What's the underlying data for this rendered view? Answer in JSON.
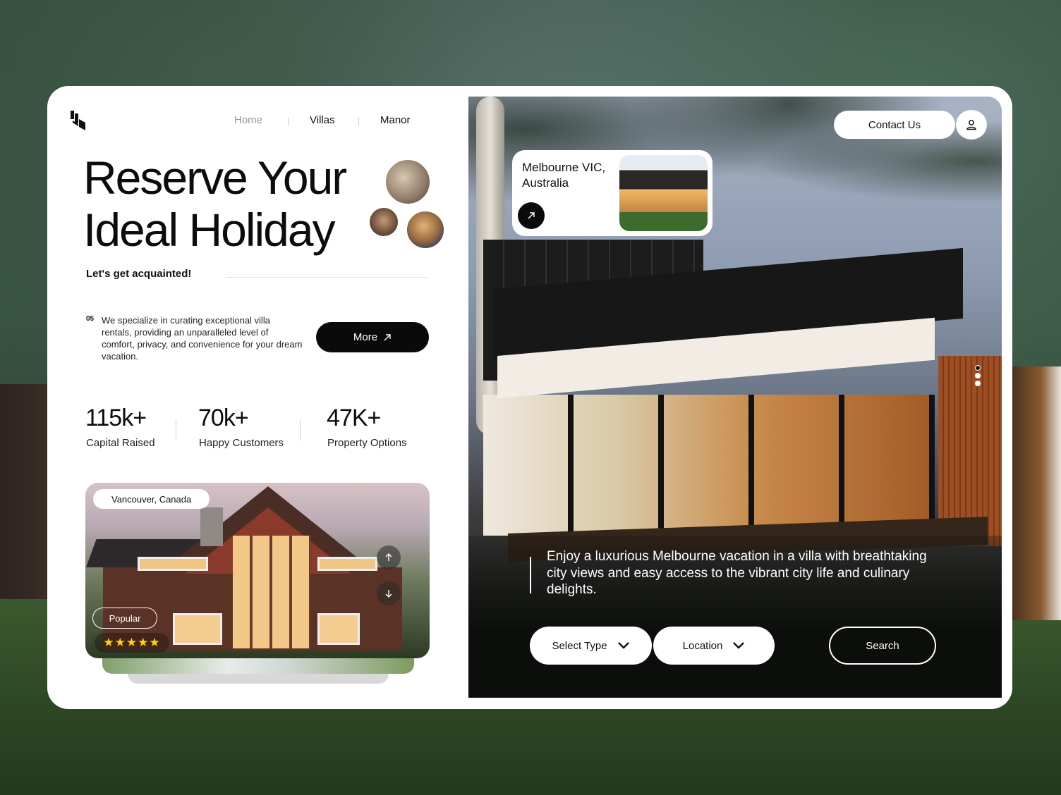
{
  "nav": {
    "home": "Home",
    "villas": "Villas",
    "manor": "Manor"
  },
  "hero": {
    "title_line1": "Reserve Your",
    "title_line2": "Ideal Holiday",
    "subtitle": "Let's get acquainted!",
    "desc_number": "05",
    "description": "We specialize in curating exceptional villa rentals, providing an unparalleled level of comfort, privacy, and convenience for your dream vacation.",
    "more_label": "More"
  },
  "stats": [
    {
      "value": "115k+",
      "label": "Capital Raised"
    },
    {
      "value": "70k+",
      "label": "Happy Customers"
    },
    {
      "value": "47K+",
      "label": "Property Options"
    }
  ],
  "property_card": {
    "location": "Vancouver, Canada",
    "badge": "Popular",
    "stars": "★★★★★",
    "rating": 5
  },
  "header": {
    "contact_label": "Contact Us"
  },
  "featured": {
    "location": "Melbourne VIC, Australia"
  },
  "tagline": "Enjoy a luxurious Melbourne vacation in a villa with breathtaking city views and easy access to the vibrant city life and culinary delights.",
  "search": {
    "type_label": "Select Type",
    "location_label": "Location",
    "search_label": "Search"
  },
  "colors": {
    "primary": "#0a0a0a",
    "star": "#ffd200",
    "card": "#ffffff"
  }
}
